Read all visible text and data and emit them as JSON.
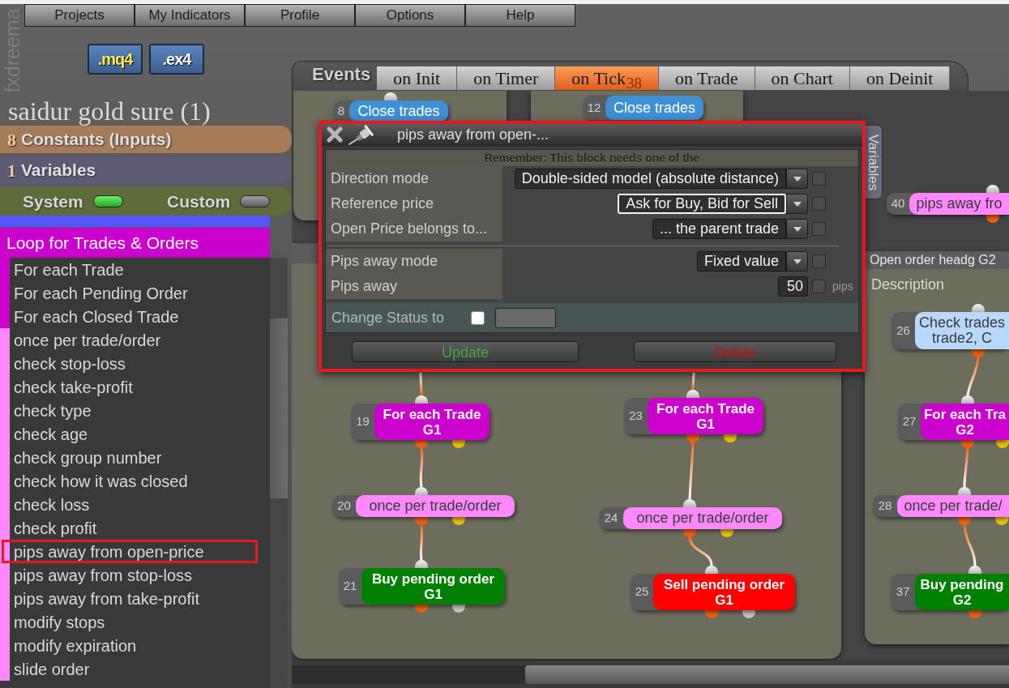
{
  "app": {
    "brand": "fxdreema",
    "menu": [
      "Projects",
      "My Indicators",
      "Profile",
      "Options",
      "Help"
    ],
    "export_buttons": [
      {
        "label": ".mq4",
        "kind": "mq4"
      },
      {
        "label": ".ex4",
        "kind": "ex4"
      }
    ]
  },
  "sidebar": {
    "project_title": "saidur gold sure (1)",
    "sections": [
      {
        "kind": "constants",
        "count": "8",
        "label": "Constants (Inputs)"
      },
      {
        "kind": "variables",
        "count": "1",
        "label": "Variables"
      }
    ],
    "filters": [
      {
        "label": "System",
        "on": true
      },
      {
        "label": "Custom",
        "on": false
      }
    ],
    "category": "Loop for Trades & Orders",
    "items": [
      {
        "label": "For each Trade",
        "color": "#cc00cc",
        "selected": false
      },
      {
        "label": "For each Pending Order",
        "color": "#cc00cc",
        "selected": false
      },
      {
        "label": "For each Closed Trade",
        "color": "#cc00cc",
        "selected": false
      },
      {
        "label": "once per trade/order",
        "color": "#ff88ff",
        "selected": false
      },
      {
        "label": "check stop-loss",
        "color": "#ff88ff",
        "selected": false
      },
      {
        "label": "check take-profit",
        "color": "#ff88ff",
        "selected": false
      },
      {
        "label": "check type",
        "color": "#ff88ff",
        "selected": false
      },
      {
        "label": "check age",
        "color": "#ff88ff",
        "selected": false
      },
      {
        "label": "check group number",
        "color": "#ff88ff",
        "selected": false
      },
      {
        "label": "check how it was closed",
        "color": "#ff88ff",
        "selected": false
      },
      {
        "label": "check loss",
        "color": "#ff88ff",
        "selected": false
      },
      {
        "label": "check profit",
        "color": "#ff88ff",
        "selected": false
      },
      {
        "label": "pips away from open-price",
        "color": "#ff88ff",
        "selected": true
      },
      {
        "label": "pips away from stop-loss",
        "color": "#ff88ff",
        "selected": false
      },
      {
        "label": "pips away from take-profit",
        "color": "#ff88ff",
        "selected": false
      },
      {
        "label": "modify stops",
        "color": "#ff88ff",
        "selected": false
      },
      {
        "label": "modify expiration",
        "color": "#ff88ff",
        "selected": false
      },
      {
        "label": "slide order",
        "color": "#ff88ff",
        "selected": false
      }
    ]
  },
  "events": {
    "label": "Events",
    "tabs": [
      {
        "label": "on Init",
        "selected": false
      },
      {
        "label": "on Timer",
        "selected": false
      },
      {
        "label": "on Tick",
        "count": "38",
        "selected": true
      },
      {
        "label": "on Trade",
        "selected": false
      },
      {
        "label": "on Chart",
        "selected": false
      },
      {
        "label": "on Deinit",
        "selected": false
      }
    ]
  },
  "canvas": {
    "group": {
      "title": "Open order headg G2",
      "description": "Description"
    },
    "variables_tab": "Variables",
    "blocks": [
      {
        "id": "8",
        "label": "Close trades",
        "kind": "soft",
        "color": "#3f8fd4"
      },
      {
        "id": "12",
        "label": "Close trades",
        "kind": "soft",
        "color": "#3f8fd4"
      },
      {
        "id": "40",
        "label": "pips away fro",
        "kind": "light",
        "color": "#ff88ff",
        "outputs": [
          {
            "color": "#f06010"
          }
        ]
      },
      {
        "id": "26",
        "label": "Check trades",
        "detail": "trade2, C",
        "kind": "light",
        "color": "#b9d8ff",
        "outputs": [
          {
            "color": "#f06010"
          }
        ]
      },
      {
        "id": "19",
        "label": "For each Trade",
        "detail": "G1",
        "kind": "strong",
        "color": "#cc00cc",
        "outputs": [
          {
            "color": "#f06010"
          },
          {
            "color": "#e8c000"
          }
        ]
      },
      {
        "id": "23",
        "label": "For each Trade",
        "detail": "G1",
        "kind": "strong",
        "color": "#cc00cc",
        "outputs": [
          {
            "color": "#f06010"
          },
          {
            "color": "#e8c000"
          }
        ]
      },
      {
        "id": "27",
        "label": "For each Tra",
        "detail": "G2",
        "kind": "strong",
        "color": "#cc00cc",
        "outputs": [
          {
            "color": "#f06010"
          },
          {
            "color": "#e8c000"
          }
        ]
      },
      {
        "id": "20",
        "label": "once per trade/order",
        "kind": "light",
        "color": "#ff88ff",
        "outputs": [
          {
            "color": "#f06010"
          },
          {
            "color": "#e8c000"
          }
        ]
      },
      {
        "id": "24",
        "label": "once per trade/order",
        "kind": "light",
        "color": "#ff88ff",
        "outputs": [
          {
            "color": "#f06010"
          },
          {
            "color": "#e8c000"
          }
        ]
      },
      {
        "id": "28",
        "label": "once per trade/",
        "kind": "light",
        "color": "#ff88ff",
        "outputs": [
          {
            "color": "#f06010"
          },
          {
            "color": "#e8c000"
          }
        ]
      },
      {
        "id": "21",
        "label": "Buy pending order",
        "detail": "G1",
        "kind": "strong",
        "color": "#008000",
        "outputs": [
          {
            "color": "#f06010"
          },
          {
            "color": "#c4c4c4"
          }
        ]
      },
      {
        "id": "25",
        "label": "Sell pending order",
        "detail": "G1",
        "kind": "strong",
        "color": "#ff0000",
        "outputs": [
          {
            "color": "#f06010"
          },
          {
            "color": "#c4c4c4"
          }
        ]
      },
      {
        "id": "37",
        "label": "Buy pending",
        "detail": "G2",
        "kind": "strong",
        "color": "#008000",
        "outputs": [
          {
            "color": "#f06010"
          }
        ]
      }
    ]
  },
  "dialog": {
    "highlighted": true,
    "title": "pips away from open-...",
    "notice": "Remember: This block needs one of the",
    "sections": [
      {
        "fields": [
          {
            "label": "Direction mode",
            "kind": "select",
            "value": "Double-sided model (absolute distance)",
            "focused": false,
            "checked": false
          },
          {
            "label": "Reference price",
            "kind": "select",
            "value": "Ask for Buy, Bid for Sell",
            "focused": true,
            "checked": false
          },
          {
            "label": "Open Price belongs to...",
            "kind": "select",
            "value": "... the parent trade",
            "focused": false,
            "checked": false
          }
        ]
      },
      {
        "fields": [
          {
            "label": "Pips away mode",
            "kind": "select",
            "value": "Fixed value",
            "focused": false,
            "checked": false
          },
          {
            "label": "Pips away",
            "kind": "number",
            "value": "50",
            "unit": "pips",
            "checked": false
          }
        ]
      }
    ],
    "status": {
      "label": "Change Status to",
      "checked": false
    },
    "buttons": [
      {
        "label": "Update",
        "kind": "update"
      },
      {
        "label": "Delete",
        "kind": "delete"
      }
    ]
  }
}
